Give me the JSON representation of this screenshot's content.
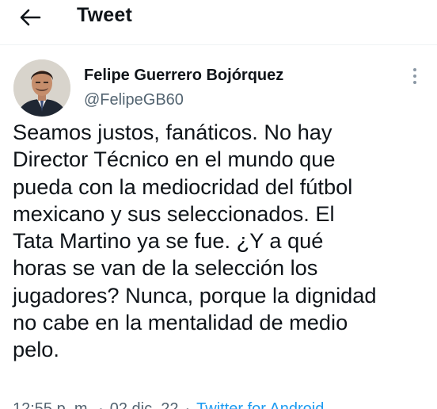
{
  "header": {
    "title": "Tweet",
    "back_icon": "arrow-left-icon"
  },
  "author": {
    "name": "Felipe Guerrero Bojórquez",
    "handle": "@FelipeGB60",
    "more_icon": "more-vertical-icon"
  },
  "tweet": {
    "lines": [
      "Seamos justos, fanáticos. No hay",
      "Director Técnico en el mundo que",
      "pueda con la mediocridad del fútbol",
      "mexicano y sus seleccionados. El",
      "Tata Martino ya se fue. ¿Y a qué",
      "horas se van de la selección los",
      "jugadores? Nunca, porque la dignidad",
      "no cabe en la mentalidad de medio",
      "pelo."
    ]
  },
  "meta": {
    "time": "12:55 p. m.",
    "date": "02 dic. 22",
    "source": "Twitter for Android"
  },
  "colors": {
    "text": "#0f1419",
    "secondary": "#536471",
    "link": "#1d9bf0"
  }
}
